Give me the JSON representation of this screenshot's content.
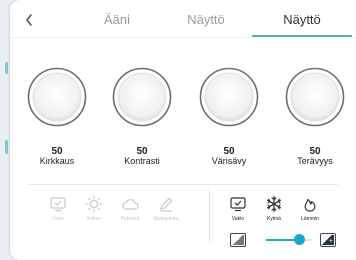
{
  "tabs": [
    {
      "label": "Ääni",
      "active": false
    },
    {
      "label": "Näyttö",
      "active": false
    },
    {
      "label": "Näyttö",
      "active": true
    }
  ],
  "back_icon": "chevron-left-icon",
  "knobs": [
    {
      "label": "Kirkkaus",
      "value": "50"
    },
    {
      "label": "Kontrasti",
      "value": "50"
    },
    {
      "label": "Värisävy",
      "value": "50"
    },
    {
      "label": "Terävyys",
      "value": "50"
    }
  ],
  "picture_modes": [
    {
      "label": "Vakio",
      "icon": "display-check-icon"
    },
    {
      "label": "Kirkas",
      "icon": "sun-icon"
    },
    {
      "label": "Pehmeä",
      "icon": "cloud-icon"
    },
    {
      "label": "Mukautettu",
      "icon": "pencil-icon"
    }
  ],
  "color_modes": [
    {
      "label": "Vakio",
      "icon": "display-check-icon"
    },
    {
      "label": "Kylmä",
      "icon": "snowflake-icon"
    },
    {
      "label": "Lämmin",
      "icon": "flame-icon"
    }
  ],
  "contrast_slider": {
    "value_fraction": 0.72
  },
  "colors": {
    "accent": "#1fa8c6",
    "tab_underline": "#5aaec0"
  }
}
